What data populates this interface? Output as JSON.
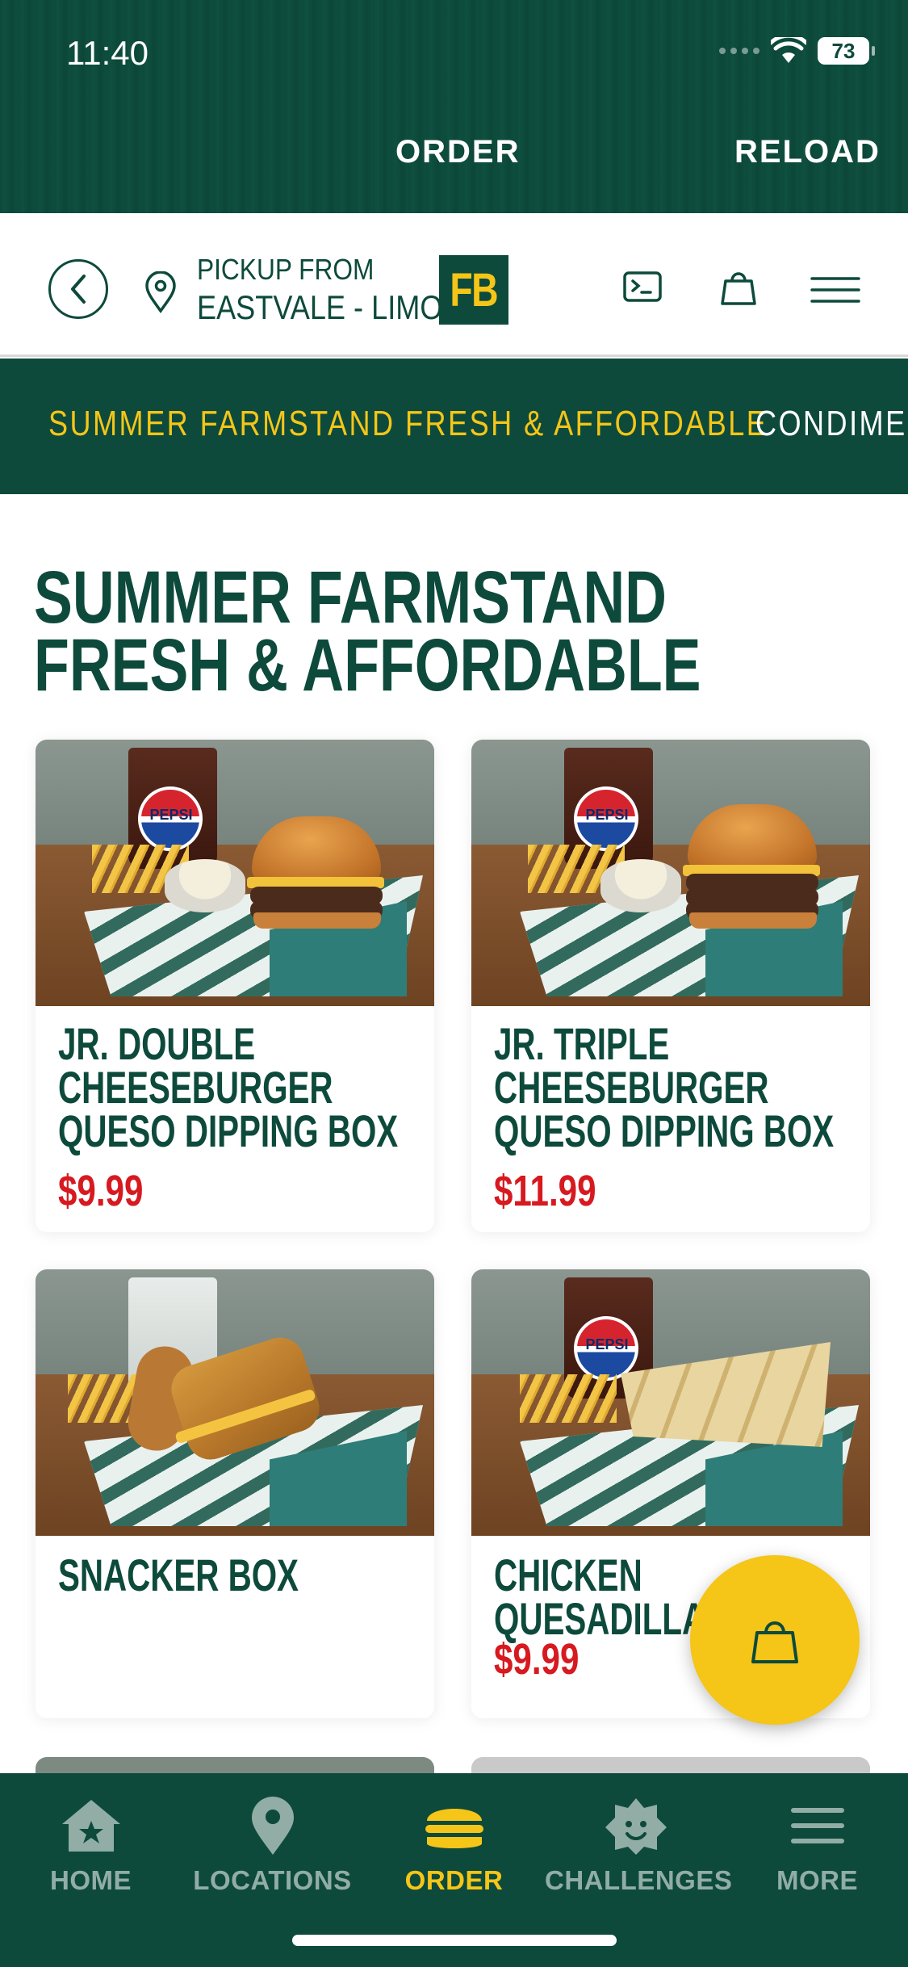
{
  "status_bar": {
    "time": "11:40",
    "battery": "73"
  },
  "top_nav": {
    "order": "ORDER",
    "reload": "RELOAD"
  },
  "pickup": {
    "label": "PICKUP FROM",
    "location": "EASTVALE - LIMO...",
    "logo": "FB"
  },
  "header_icons": [
    "back-arrow-icon",
    "location-pin-icon",
    "terminal-card-icon",
    "bag-icon",
    "hamburger-menu-icon"
  ],
  "categories": {
    "active": "SUMMER FARMSTAND FRESH & AFFORDABLE",
    "next": "CONDIMEN"
  },
  "section": {
    "title": "SUMMER FARMSTAND FRESH & AFFORDABLE"
  },
  "products": [
    {
      "name": "JR. DOUBLE CHEESEBURGER QUESO DIPPING BOX",
      "price": "$9.99",
      "drink_brand": "PEPSI"
    },
    {
      "name": "JR. TRIPLE CHEESEBURGER QUESO DIPPING BOX",
      "price": "$11.99",
      "drink_brand": "PEPSI"
    },
    {
      "name": "SNACKER BOX",
      "price": ""
    },
    {
      "name": "CHICKEN QUESADILLA BOX",
      "price": "$9.99",
      "drink_brand": "PEPSI"
    }
  ],
  "bottom_nav": {
    "tabs": [
      {
        "label": "HOME",
        "icon": "home-star-icon"
      },
      {
        "label": "LOCATIONS",
        "icon": "location-pin-icon"
      },
      {
        "label": "ORDER",
        "icon": "burger-icon",
        "active": true
      },
      {
        "label": "CHALLENGES",
        "icon": "challenge-badge-icon"
      },
      {
        "label": "MORE",
        "icon": "menu-lines-icon"
      }
    ]
  },
  "colors": {
    "brand_green": "#0d4a3b",
    "brand_yellow": "#f5c518",
    "price_red": "#d71920"
  }
}
